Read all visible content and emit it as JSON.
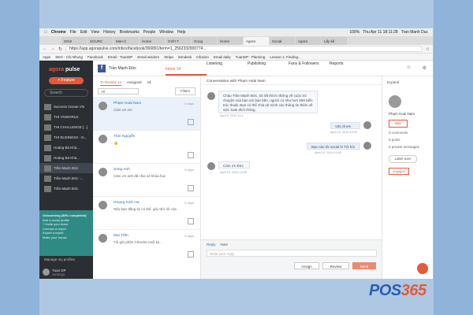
{
  "mac_menu": [
    "Chrome",
    "File",
    "Edit",
    "View",
    "History",
    "Bookmarks",
    "People",
    "Window",
    "Help"
  ],
  "mac_status": {
    "battery": "100%",
    "clock": "Thu Apr 11  18:11:28",
    "user": "Tran Manh Duc"
  },
  "tabs": [
    "2019",
    "SOURC",
    "Man-C",
    "Home",
    "GIỚI T",
    "Goog",
    "Home",
    "Agora",
    "Social",
    "Agora",
    "Lấy kế"
  ],
  "active_tab_index": 7,
  "url": "https://app.agorapulse.com/inbox/facebook/366891/term=1_2562332000774...",
  "bookmarks": [
    "Apps",
    "SEO - Chị Nhung",
    "Facebook",
    "Email - TuanDP",
    "Email wisdom",
    "Stripe",
    "Zendesk",
    "Infusion",
    "Email daily",
    "TuanDP - Planning",
    "Lesson 1: Finding..."
  ],
  "sidebar": {
    "logo_a": "agora",
    "logo_b": "pulse",
    "feature_btn": "+ Feature",
    "search": "Search",
    "items": [
      {
        "label": "Success Ocean VN"
      },
      {
        "label": "THI VNWORLD"
      },
      {
        "label": "THI CHALLENGE [...]"
      },
      {
        "label": "THI BUSINESS - D..."
      },
      {
        "label": "Hoàng Bá Khá..."
      },
      {
        "label": "Hoàng Bá Khá..."
      },
      {
        "label": "Trần Mạnh Đức"
      },
      {
        "label": "Trần Mạnh Đức -..."
      },
      {
        "label": "Trần Mạnh Đức"
      }
    ],
    "onboard": {
      "title": "Onboarding (80% completed)",
      "lines": [
        "Add a social profile",
        "+ Invite your team",
        "Connect a report",
        "Export a report",
        "Make your house"
      ]
    },
    "manage": "Manage my profiles",
    "user_name": "Tuan DP",
    "user_sub": "Settings"
  },
  "topbar": {
    "account": "Trần Mạnh Đức",
    "nav": [
      "Inbox 14",
      "Listening",
      "Publishing",
      "Fans & Followers",
      "Reports"
    ]
  },
  "list": {
    "subtabs": [
      "To Review 14",
      "Assigned",
      "All"
    ],
    "select": "All",
    "filters": "Filters",
    "messages": [
      {
        "name": "Phạm Hoài Nam",
        "text": "Cảm ơn em",
        "time": "4 days"
      },
      {
        "name": "Tôm Nguyễn",
        "text": "👍",
        "time": ""
      },
      {
        "name": "Song Anh",
        "text": "Cảm ơn anh đã chia sẻ khóa học",
        "time": "5 days"
      },
      {
        "name": "Hoang Kinh Ha",
        "text": "Nếu bạn đăng ký có thể, giá nhờ tôi của M 2/31/08",
        "time": "5 days"
      },
      {
        "name": "Mai Trần",
        "text": "Tôi gửi phản Chiacke nuổi kỳ...",
        "time": "5 days"
      }
    ]
  },
  "conversation": {
    "title": "Conversation with Phạm Hoài Nam",
    "msg1": "Chào Trần Mạnh Đức, tôi rất thích những về cuộc trò chuyện của bạn với bạn bên, người có nhu hơn 500 kiến trúc thuật. Bạn có thể chia sẻ mình các thông tin thêm về việc Sale đích thông.",
    "msg1_time": "April 9, 2019 14:1",
    "msg2": "Vân đi em",
    "msg2_time": "April 10, 2019 10:00",
    "msg3": "Bạn cảo tôi social hi Tôi hỏi",
    "msg3_time": "April 10, 2019 10:00",
    "msg4": "Cảm ơn Đức",
    "msg4_time": "April 10, 2019 14:00",
    "reply_tabs": [
      "Reply",
      "Note"
    ],
    "reply_placeholder": "Write your reply",
    "assign": "Assign",
    "review": "Review",
    "send": "Send"
  },
  "profile": {
    "expand": "Expand",
    "name": "Phạm Hoài Nam",
    "ban": "Ban",
    "stats": [
      "0 comments",
      "0 posts",
      "2 private messages"
    ],
    "label_btn": "Label user",
    "tag": "engaged"
  },
  "brandmark": {
    "a": "POS",
    "b": "365"
  },
  "colors": {
    "accent": "#e35b3a",
    "sidebar": "#2b2f33",
    "link": "#2d6cb5"
  }
}
